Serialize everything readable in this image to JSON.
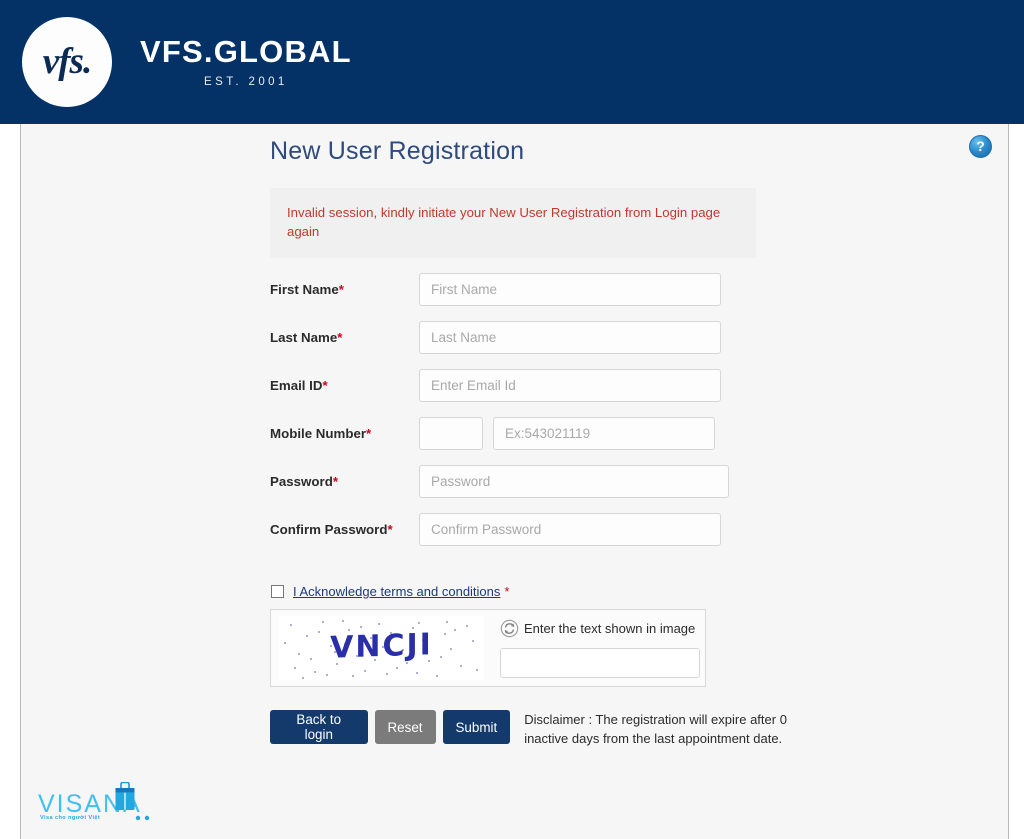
{
  "header": {
    "logo_mark": "vfs.",
    "brand_name": "VFS.GLOBAL",
    "brand_est": "EST. 2001",
    "brand_bg": "#043267"
  },
  "help": {
    "icon_label": "?",
    "icon_name": "help-icon"
  },
  "page": {
    "title": "New User Registration",
    "title_color": "#2f4a7c"
  },
  "alert": {
    "message": "Invalid session, kindly initiate your New User Registration from Login page again",
    "color": "#c0392b",
    "bg": "#f0f0f0"
  },
  "form": {
    "required_marker": "*",
    "fields": [
      {
        "label": "First Name",
        "placeholder": "First Name",
        "value": ""
      },
      {
        "label": "Last Name",
        "placeholder": "Last Name",
        "value": ""
      },
      {
        "label": "Email ID",
        "placeholder": "Enter Email Id",
        "value": ""
      },
      {
        "label": "Password",
        "placeholder": "Password",
        "value": ""
      },
      {
        "label": "Confirm Password",
        "placeholder": "Confirm Password",
        "value": ""
      }
    ],
    "mobile": {
      "label": "Mobile Number",
      "country_code_placeholder": "",
      "country_code_value": "",
      "number_placeholder": "Ex:543021119",
      "number_value": ""
    }
  },
  "terms": {
    "checked": false,
    "link_text": "I Acknowledge terms and conditions",
    "required_marker": "*",
    "link_color": "#1a3a7a"
  },
  "captcha": {
    "image_text": "VNCJI",
    "image_text_color": "#2a2fa8",
    "refresh_icon": "refresh-icon",
    "instruction": "Enter the text shown in image",
    "input_value": "",
    "input_placeholder": ""
  },
  "buttons": {
    "back_to_login": "Back to login",
    "reset": "Reset",
    "submit": "Submit",
    "primary_color": "#133a6b",
    "reset_color": "#7b7b7b"
  },
  "disclaimer": {
    "text": "Disclaimer : The registration will expire after 0 inactive days from the last appointment date."
  },
  "footer": {
    "logo_word": "VISANA",
    "logo_tagline": "Visa cho người Việt",
    "logo_color": "#3fc1ef"
  }
}
